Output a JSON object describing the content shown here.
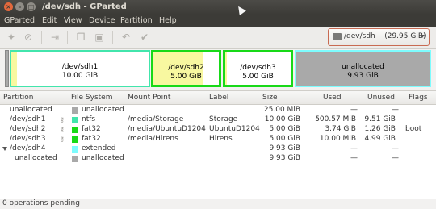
{
  "window": {
    "title": "/dev/sdh - GParted"
  },
  "menu": [
    "GParted",
    "Edit",
    "View",
    "Device",
    "Partition",
    "Help"
  ],
  "toolbar": {
    "icons": [
      "new-partition-icon",
      "delete-icon",
      "resize-move-icon",
      "copy-icon",
      "paste-icon",
      "undo-icon",
      "apply-icon"
    ]
  },
  "device_selector": {
    "device": "/dev/sdh",
    "size": "(29.95 GiB)"
  },
  "disk_map": [
    {
      "name": "/dev/sdh1",
      "size": "10.00 GiB"
    },
    {
      "name": "/dev/sdh2",
      "size": "5.00 GiB"
    },
    {
      "name": "/dev/sdh3",
      "size": "5.00 GiB"
    },
    {
      "name": "unallocated",
      "size": "9.93 GiB"
    }
  ],
  "table": {
    "headers": [
      "Partition",
      "File System",
      "Mount Point",
      "Label",
      "Size",
      "Used",
      "Unused",
      "Flags"
    ],
    "rows": [
      {
        "partition": "unallocated",
        "fs": "unallocated",
        "fs_color": "#a9a9a9",
        "mount": "",
        "label": "",
        "size": "25.00 MiB",
        "used": "—",
        "unused": "—",
        "flags": ""
      },
      {
        "partition": "/dev/sdh1",
        "fs": "ntfs",
        "fs_color": "#42e5ac",
        "mount": "/media/Storage",
        "label": "Storage",
        "size": "10.00 GiB",
        "used": "500.57 MiB",
        "unused": "9.51 GiB",
        "flags": ""
      },
      {
        "partition": "/dev/sdh2",
        "fs": "fat32",
        "fs_color": "#18d918",
        "mount": "/media/UbuntuD1204",
        "label": "UbuntuD1204",
        "size": "5.00 GiB",
        "used": "3.74 GiB",
        "unused": "1.26 GiB",
        "flags": "boot"
      },
      {
        "partition": "/dev/sdh3",
        "fs": "fat32",
        "fs_color": "#18d918",
        "mount": "/media/Hirens",
        "label": "Hirens",
        "size": "5.00 GiB",
        "used": "10.00 MiB",
        "unused": "4.99 GiB",
        "flags": ""
      },
      {
        "partition": "/dev/sdh4",
        "fs": "extended",
        "fs_color": "#7dfcfe",
        "mount": "",
        "label": "",
        "size": "9.93 GiB",
        "used": "—",
        "unused": "—",
        "flags": ""
      },
      {
        "partition": "unallocated",
        "fs": "unallocated",
        "fs_color": "#a9a9a9",
        "mount": "",
        "label": "",
        "size": "9.93 GiB",
        "used": "—",
        "unused": "—",
        "flags": ""
      }
    ]
  },
  "status": "0 operations pending"
}
